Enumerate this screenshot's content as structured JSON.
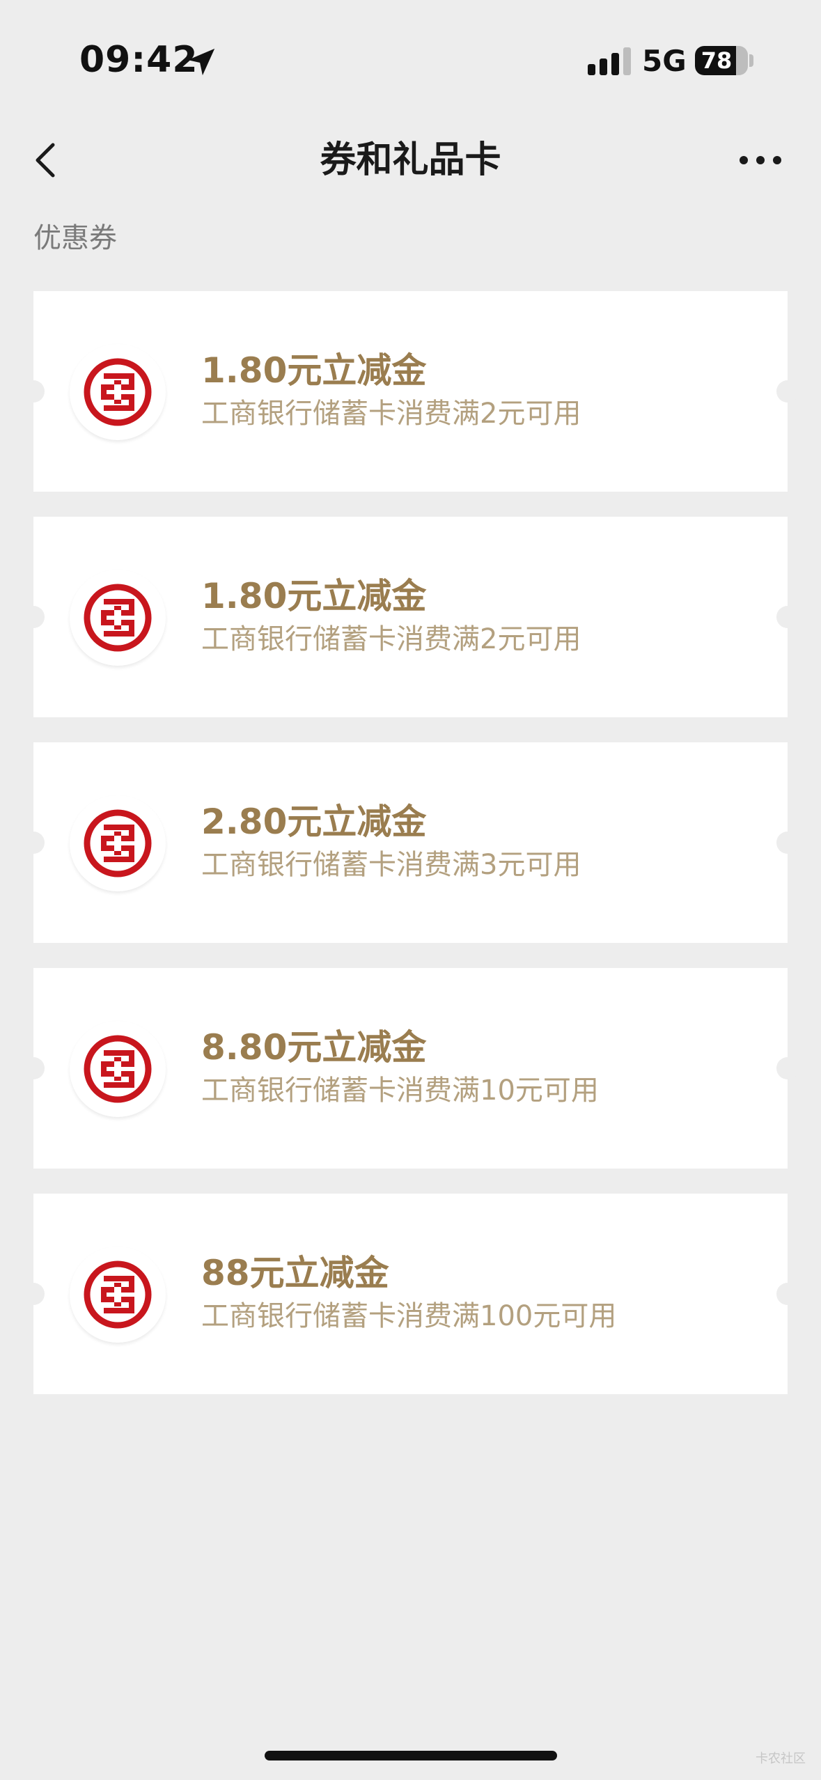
{
  "status_bar": {
    "time": "09:42",
    "network": "5G",
    "battery": "78",
    "battery_fraction": 0.78
  },
  "nav": {
    "title": "券和礼品卡",
    "back_icon": "chevron-left-icon",
    "more_icon": "more-dots-icon"
  },
  "section": {
    "title": "优惠券"
  },
  "coupons": [
    {
      "title": "1.80元立减金",
      "desc": "工商银行储蓄卡消费满2元可用"
    },
    {
      "title": "1.80元立减金",
      "desc": "工商银行储蓄卡消费满2元可用"
    },
    {
      "title": "2.80元立减金",
      "desc": "工商银行储蓄卡消费满3元可用"
    },
    {
      "title": "8.80元立减金",
      "desc": "工商银行储蓄卡消费满10元可用"
    },
    {
      "title": "88元立减金",
      "desc": "工商银行储蓄卡消费满100元可用"
    }
  ],
  "watermark": "卡农社区",
  "colors": {
    "background": "#ededed",
    "card": "#ffffff",
    "coupon_title": "#9a7d4f",
    "coupon_desc": "#b3a07f",
    "bank_logo_red": "#c8161d"
  }
}
